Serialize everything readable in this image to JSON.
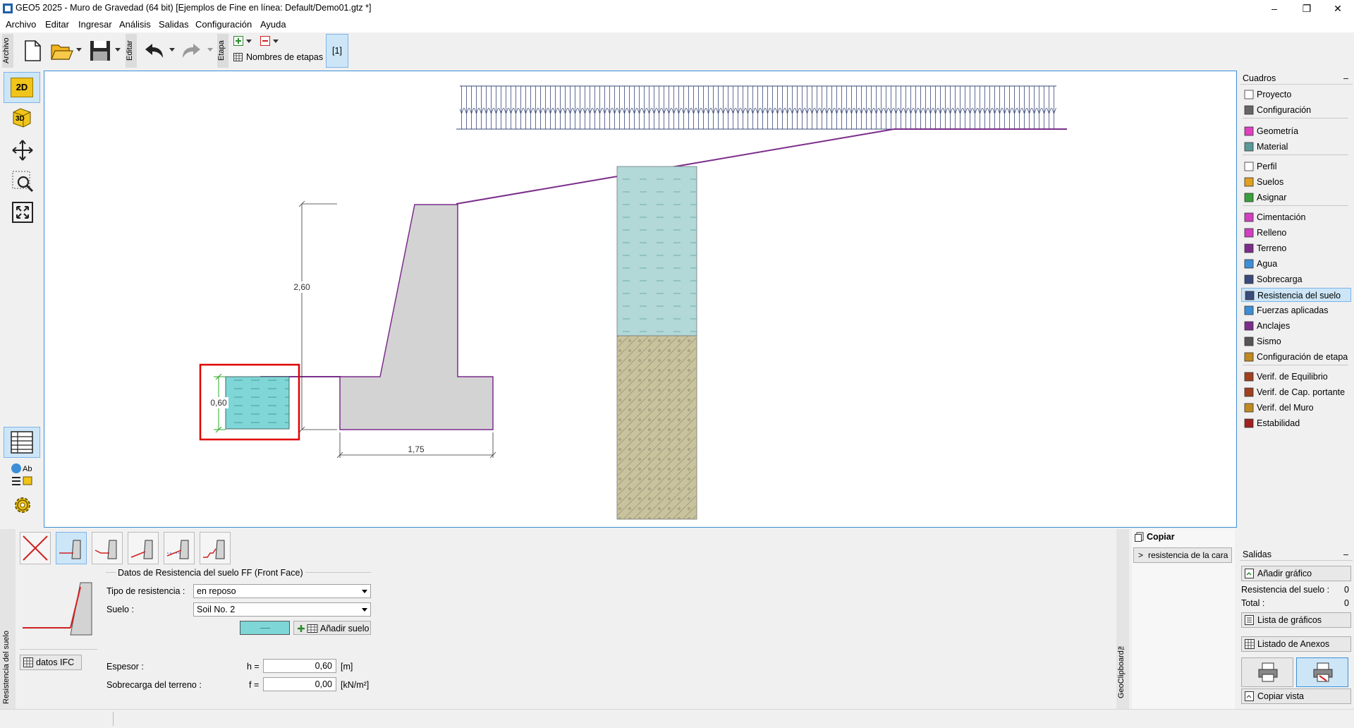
{
  "window": {
    "title": "GEO5 2025 - Muro de Gravedad (64 bit) [Ejemplos de Fine en línea: Default/Demo01.gtz *]"
  },
  "menu": [
    "Archivo",
    "Editar",
    "Ingresar",
    "Análisis",
    "Salidas",
    "Configuración",
    "Ayuda"
  ],
  "toolbar": {
    "archivo_tab": "Archivo",
    "editar_tab": "Editar",
    "etapa_tab": "Etapa",
    "stage_names": "Nombres de etapas",
    "stage_button": "[1]"
  },
  "leftbar": {
    "btn_2d": "2D",
    "btn_3d": "3D"
  },
  "drawing": {
    "dim_height": "2,60",
    "dim_thickness": "0,60",
    "dim_width": "1,75"
  },
  "frames": {
    "header": "Cuadros",
    "items": [
      {
        "label": "Proyecto",
        "icon": "project-icon"
      },
      {
        "label": "Configuración",
        "icon": "settings-gear-icon"
      },
      {
        "label": "Geometría",
        "icon": "geometry-icon"
      },
      {
        "label": "Material",
        "icon": "material-icon"
      },
      {
        "label": "Perfil",
        "icon": "profile-icon"
      },
      {
        "label": "Suelos",
        "icon": "soils-icon"
      },
      {
        "label": "Asignar",
        "icon": "assign-icon"
      },
      {
        "label": "Cimentación",
        "icon": "foundation-icon"
      },
      {
        "label": "Relleno",
        "icon": "backfill-icon"
      },
      {
        "label": "Terreno",
        "icon": "terrain-icon"
      },
      {
        "label": "Agua",
        "icon": "water-icon"
      },
      {
        "label": "Sobrecarga",
        "icon": "surcharge-icon"
      },
      {
        "label": "Resistencia del suelo",
        "icon": "resistance-icon"
      },
      {
        "label": "Fuerzas aplicadas",
        "icon": "forces-icon"
      },
      {
        "label": "Anclajes",
        "icon": "anchors-icon"
      },
      {
        "label": "Sismo",
        "icon": "earthquake-icon"
      },
      {
        "label": "Configuración de etapa",
        "icon": "stage-settings-icon"
      },
      {
        "label": "Verif. de Equilibrio",
        "icon": "equilibrium-icon"
      },
      {
        "label": "Verif. de Cap. portante",
        "icon": "bearing-icon"
      },
      {
        "label": "Verif. del Muro",
        "icon": "wall-check-icon"
      },
      {
        "label": "Estabilidad",
        "icon": "stability-icon"
      }
    ]
  },
  "outputs": {
    "header": "Salidas",
    "add_graphic": "Añadir gráfico",
    "resistance_label": "Resistencia del suelo :",
    "resistance_count": "0",
    "total_label": "Total :",
    "total_count": "0",
    "graphics_list": "Lista de gráficos",
    "annex_list": "Listado de Anexos",
    "copy_view": "Copiar vista"
  },
  "clipboard": {
    "copy": "Copiar",
    "item": "resistencia de la cara",
    "vtab": "GeoClipboard™"
  },
  "form": {
    "vtab": "Resistencia del suelo",
    "section": "Datos de Resistencia del suelo FF (Front Face)",
    "type_label": "Tipo de resistencia :",
    "type_value": "en reposo",
    "soil_label": "Suelo :",
    "soil_value": "Soil No. 2",
    "add_soil": "Añadir suelo",
    "ifc": "datos IFC",
    "thickness_label": "Espesor :",
    "thickness_var": "h =",
    "thickness_value": "0,60",
    "thickness_unit": "[m]",
    "surcharge_label": "Sobrecarga del terreno :",
    "surcharge_var": "f =",
    "surcharge_value": "0,00",
    "surcharge_unit": "[kN/m²]"
  },
  "colors": {
    "accent": "#3c8fd6",
    "wall": "#d3d3d3",
    "water": "#b2d8d8",
    "soil": "#c8c39c",
    "selection": "#e00000",
    "terrain": "#7b2d8b"
  }
}
